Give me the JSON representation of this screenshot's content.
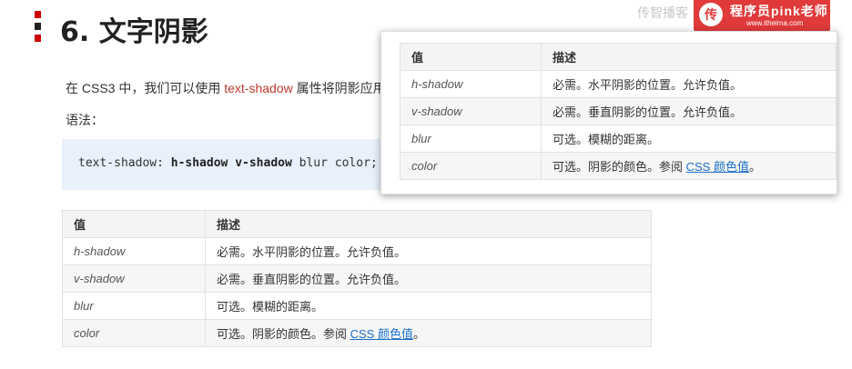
{
  "heading": {
    "title": "6. 文字阴影"
  },
  "brand": {
    "logo_char": "传",
    "name": "程序员pink老师",
    "url": "www.itheima.com",
    "watermark": "传智播客"
  },
  "intro": {
    "before": "在 CSS3 中，我们可以使用 ",
    "keyword": "text-shadow",
    "after": " 属性将阴影应用于文本。"
  },
  "syntax_label": "语法：",
  "code": {
    "prefix": "text-shadow: ",
    "bold": "h-shadow v-shadow",
    "suffix": " blur color;"
  },
  "table": {
    "headers": [
      "值",
      "描述"
    ],
    "rows": [
      {
        "value": "h-shadow",
        "desc": "必需。水平阴影的位置。允许负值。"
      },
      {
        "value": "v-shadow",
        "desc": "必需。垂直阴影的位置。允许负值。"
      },
      {
        "value": "blur",
        "desc": "可选。模糊的距离。"
      },
      {
        "value": "color",
        "desc": "可选。阴影的颜色。参阅 ",
        "link": "CSS 颜色值",
        "end": "。"
      }
    ]
  },
  "colors": {
    "accent": "#c00000",
    "keyword": "#c0392b",
    "link": "#1a6fc9",
    "code_bg": "#e8f0fb"
  }
}
